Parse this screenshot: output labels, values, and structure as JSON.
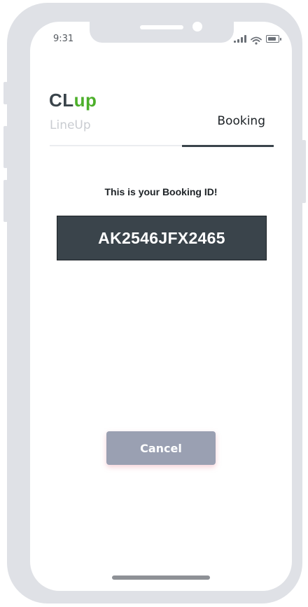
{
  "status_bar": {
    "time": "9:31",
    "icons": [
      "signal-icon",
      "wifi-icon",
      "battery-icon"
    ]
  },
  "logo": {
    "part1": "CL",
    "part2": "up"
  },
  "tabs": [
    {
      "label": "LineUp",
      "active": false
    },
    {
      "label": "Booking",
      "active": true
    }
  ],
  "booking": {
    "caption": "This is your Booking ID!",
    "id": "AK2546JFX2465"
  },
  "actions": {
    "cancel_label": "Cancel"
  },
  "colors": {
    "frame": "#dfe1e6",
    "dark": "#3a444b",
    "brand_green": "#4caf2a",
    "button": "#9aa0b2"
  }
}
